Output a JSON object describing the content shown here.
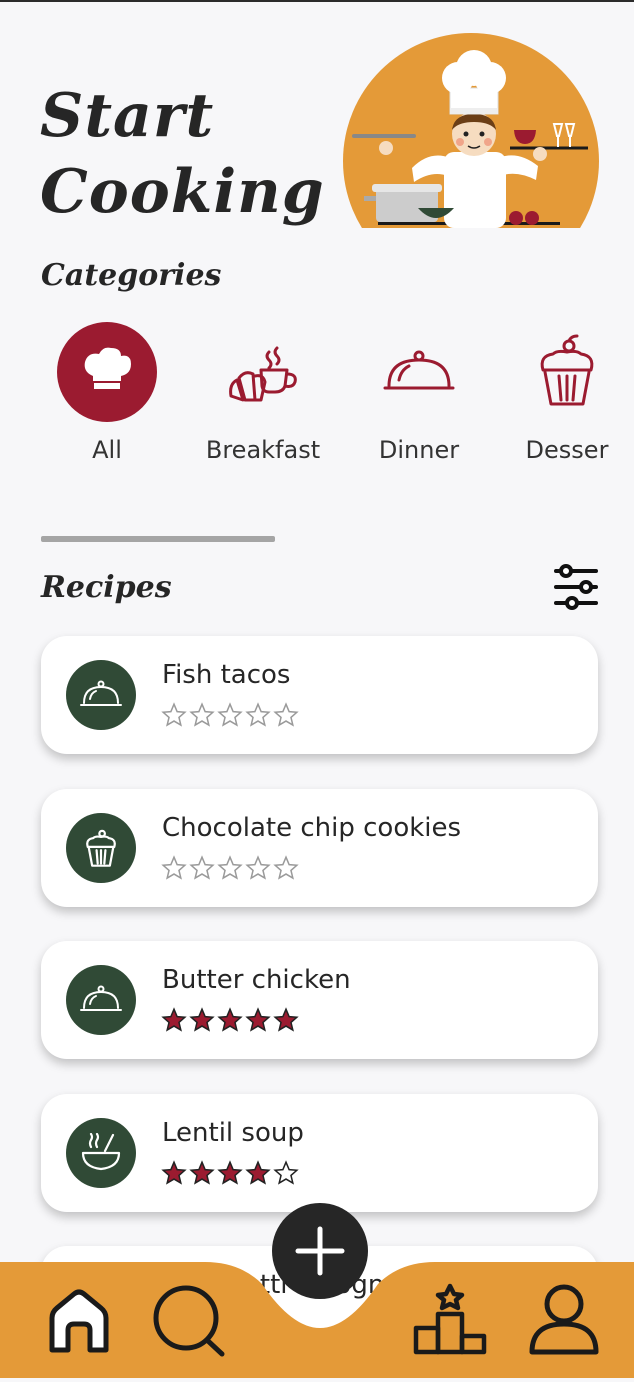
{
  "header": {
    "title_line1": "Start",
    "title_line2": "Cooking"
  },
  "categories": {
    "title": "Categories",
    "items": [
      {
        "label": "All",
        "icon": "chef-hat-icon",
        "selected": true
      },
      {
        "label": "Breakfast",
        "icon": "croissant-coffee-icon",
        "selected": false
      },
      {
        "label": "Dinner",
        "icon": "cloche-icon",
        "selected": false
      },
      {
        "label": "Desser",
        "icon": "cupcake-icon",
        "selected": false
      }
    ]
  },
  "recipes": {
    "title": "Recipes",
    "items": [
      {
        "name": "Fish tacos",
        "icon": "cloche-icon",
        "rating": 0
      },
      {
        "name": "Chocolate chip cookies",
        "icon": "cupcake-icon",
        "rating": 0
      },
      {
        "name": "Butter chicken",
        "icon": "cloche-icon",
        "rating": 5
      },
      {
        "name": "Lentil soup",
        "icon": "soup-bowl-icon",
        "rating": 4
      },
      {
        "name": "Spaghetti bolognese",
        "icon": "cloche-icon",
        "rating": 0
      }
    ]
  },
  "nav": {
    "items": [
      "home-icon",
      "search-icon",
      "add-icon",
      "leaderboard-icon",
      "profile-icon"
    ]
  },
  "colors": {
    "accent": "#9b1b30",
    "nav_bg": "#e49a38",
    "icon_circle": "#304a36",
    "fab": "#262626"
  }
}
